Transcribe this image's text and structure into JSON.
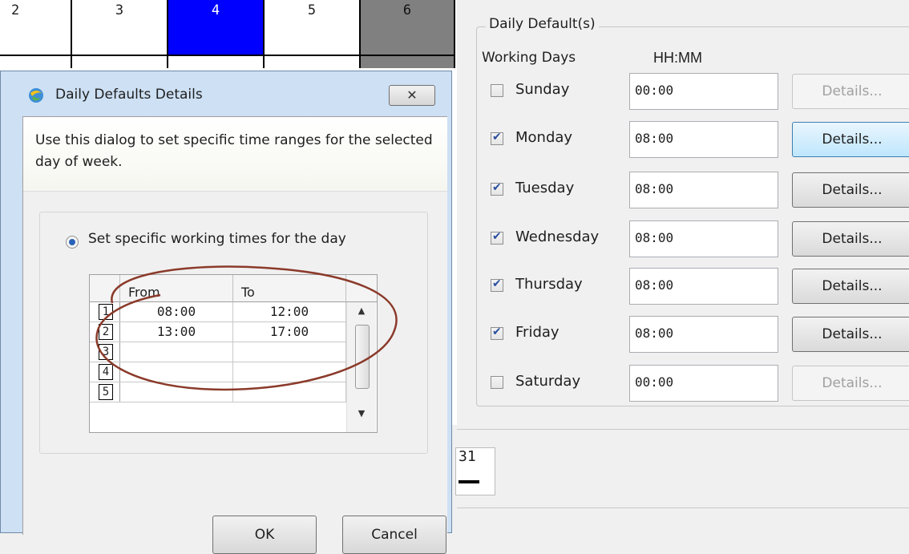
{
  "calendar": {
    "day_headers": [
      "2",
      "3",
      "4",
      "5",
      "6"
    ],
    "selected_day": "4",
    "lower_day": "31",
    "colors": {
      "selected": "#0000ff",
      "weekend": "#808080"
    }
  },
  "daily_defaults": {
    "group_title": "Daily Default(s)",
    "header_days": "Working Days",
    "header_time": "HH:MM",
    "days": [
      {
        "label": "Sunday",
        "checked": false,
        "time": "00:00",
        "details": "Details...",
        "enabled": false
      },
      {
        "label": "Monday",
        "checked": true,
        "time": "08:00",
        "details": "Details...",
        "enabled": true
      },
      {
        "label": "Tuesday",
        "checked": true,
        "time": "08:00",
        "details": "Details...",
        "enabled": true
      },
      {
        "label": "Wednesday",
        "checked": true,
        "time": "08:00",
        "details": "Details...",
        "enabled": true
      },
      {
        "label": "Thursday",
        "checked": true,
        "time": "08:00",
        "details": "Details...",
        "enabled": true
      },
      {
        "label": "Friday",
        "checked": true,
        "time": "08:00",
        "details": "Details...",
        "enabled": true
      },
      {
        "label": "Saturday",
        "checked": false,
        "time": "00:00",
        "details": "Details...",
        "enabled": false
      }
    ]
  },
  "dialog": {
    "title": "Daily Defaults Details",
    "close_glyph": "✕",
    "description": "Use this dialog to set specific time ranges for the selected day of week.",
    "radio_label": "Set specific working times for the day",
    "grid": {
      "col_from": "From",
      "col_to": "To",
      "rows": [
        {
          "num": "1",
          "from": "08:00",
          "to": "12:00"
        },
        {
          "num": "2",
          "from": "13:00",
          "to": "17:00"
        },
        {
          "num": "3",
          "from": "",
          "to": ""
        },
        {
          "num": "4",
          "from": "",
          "to": ""
        },
        {
          "num": "5",
          "from": "",
          "to": ""
        }
      ]
    },
    "ok_label": "OK",
    "cancel_label": "Cancel"
  },
  "annotation_color": "#8b3a2a"
}
